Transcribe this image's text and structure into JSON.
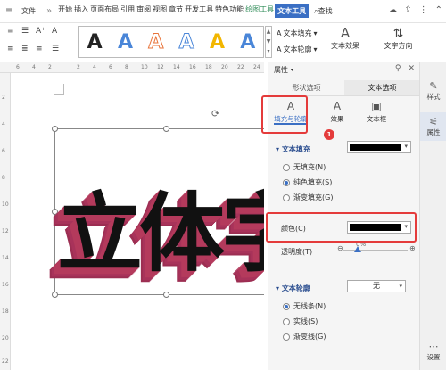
{
  "menubar": {
    "menu_icon": "≡",
    "file": "文件",
    "more": "»",
    "menus": [
      "开始",
      "插入",
      "页面布局",
      "引用",
      "审阅",
      "视图",
      "章节",
      "开发工具",
      "特色功能"
    ],
    "drawing_tools": "绘图工具",
    "text_tools": "文本工具",
    "search": "查找"
  },
  "ribbon": {
    "styles_letter": "A",
    "style_colors": [
      "#222222",
      "#4a86d8",
      "#e8743b",
      "#4a86d8",
      "#f2b600",
      "#4a86d8"
    ],
    "text_fill": "文本填充",
    "text_outline": "文本轮廓",
    "text_effect": "文本效果",
    "text_direction": "文字方向",
    "big_A": "A"
  },
  "ruler": {
    "h": [
      "6",
      "4",
      "2",
      "2",
      "4",
      "6",
      "8",
      "10",
      "12",
      "14",
      "16",
      "18",
      "20",
      "22",
      "24"
    ],
    "v": [
      "2",
      "4",
      "6",
      "8",
      "10",
      "12",
      "14",
      "16",
      "18",
      "20",
      "22"
    ]
  },
  "document": {
    "art_text": "立体字"
  },
  "panel": {
    "title": "属性",
    "tab_shape": "形状选项",
    "tab_text": "文本选项",
    "subtab_fill": "填充与轮廓",
    "subtab_effect": "效果",
    "subtab_textbox": "文本框",
    "badge1": "1",
    "badge2": "2",
    "text_fill_section": "文本填充",
    "no_fill": "无填充(N)",
    "solid_fill": "纯色填充(S)",
    "gradient_fill": "渐变填充(G)",
    "color_label": "颜色(C)",
    "transparency_label": "透明度(T)",
    "transparency_value": "0%",
    "text_outline_section": "文本轮廓",
    "outline_value": "无",
    "no_line": "无线条(N)",
    "solid_line": "实线(S)",
    "gradient_line": "渐变线(G)",
    "fill_color": "#000000"
  },
  "rightbar": {
    "edit": "样式",
    "properties": "属性",
    "settings": "设置"
  }
}
